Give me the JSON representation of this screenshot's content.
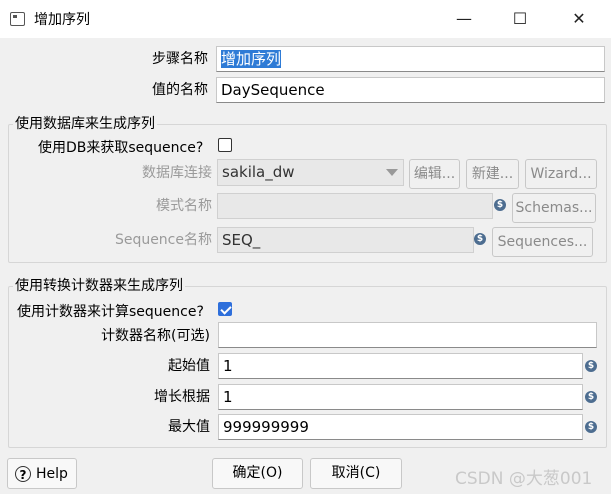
{
  "window": {
    "title": "增加序列",
    "minimize_glyph": "—",
    "maximize_glyph": "☐",
    "close_glyph": "✕"
  },
  "fields": {
    "step_name_label": "步骤名称",
    "step_name_value": "增加序列",
    "value_name_label": "值的名称",
    "value_name_value": "DaySequence"
  },
  "db_group": {
    "title": "使用数据库来生成序列",
    "use_db_label": "使用DB来获取sequence?",
    "use_db_checked": false,
    "connection_label": "数据库连接",
    "connection_value": "sakila_dw",
    "edit_button": "编辑...",
    "new_button": "新建...",
    "wizard_button": "Wizard...",
    "schema_label": "模式名称",
    "schema_value": "",
    "schemas_button": "Schemas...",
    "sequence_label": "Sequence名称",
    "sequence_value": "SEQ_",
    "sequences_button": "Sequences..."
  },
  "counter_group": {
    "title": "使用转换计数器来生成序列",
    "use_counter_label": "使用计数器来计算sequence?",
    "use_counter_checked": true,
    "counter_name_label": "计数器名称(可选)",
    "counter_name_value": "",
    "start_label": "起始值",
    "start_value": "1",
    "increment_label": "增长根据",
    "increment_value": "1",
    "max_label": "最大值",
    "max_value": "999999999"
  },
  "footer": {
    "help_button": "Help",
    "ok_button": "确定(O)",
    "cancel_button": "取消(C)",
    "watermark": "CSDN @大葱001"
  }
}
